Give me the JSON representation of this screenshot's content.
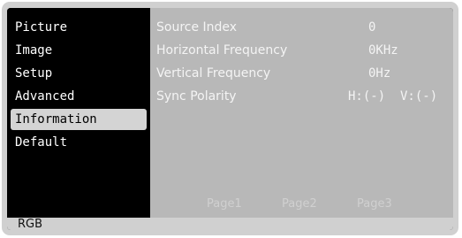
{
  "menu": {
    "items": [
      {
        "label": "Picture"
      },
      {
        "label": "Image"
      },
      {
        "label": "Setup"
      },
      {
        "label": "Advanced"
      },
      {
        "label": "Information",
        "selected": true
      },
      {
        "label": "Default"
      }
    ]
  },
  "info": {
    "rows": [
      {
        "label": "Source Index",
        "value": "0"
      },
      {
        "label": "Horizontal Frequency",
        "value": "0KHz"
      },
      {
        "label": "Vertical Frequency",
        "value": "0Hz"
      },
      {
        "label": "Sync Polarity",
        "value": "H:(-)  V:(-)"
      }
    ]
  },
  "pages": {
    "page1": "Page1",
    "page2": "Page2",
    "page3": "Page3"
  },
  "status": {
    "source": "RGB"
  },
  "colors": {
    "panel_bg": "#b8b8b8",
    "menu_bg": "#000000",
    "selected_bg": "#d4d4d4",
    "frame": "#d0d0d0"
  }
}
